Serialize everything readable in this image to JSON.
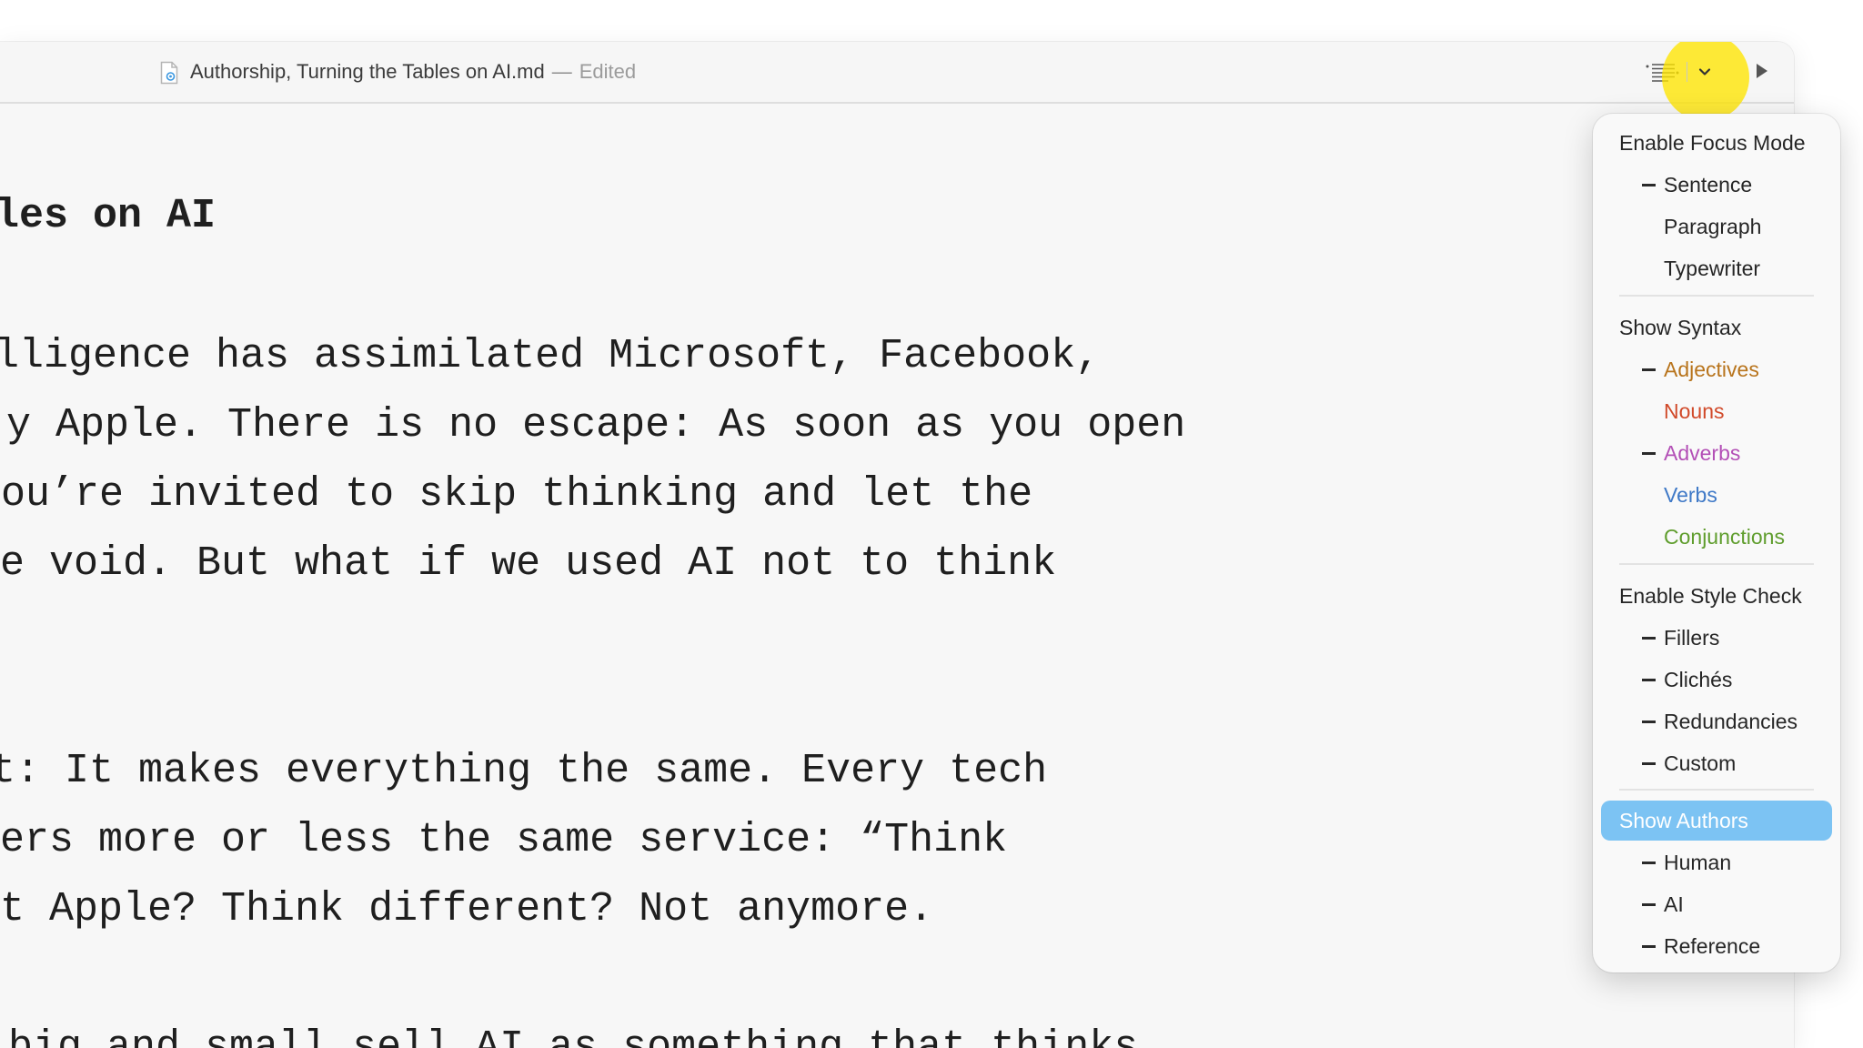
{
  "window": {
    "file_name": "Authorship, Turning the Tables on AI.md",
    "separator": "—",
    "status": "Edited"
  },
  "icons": {
    "document": "markdown-document-icon",
    "lines": "text-lines-icon",
    "chevron": "chevron-down-icon",
    "play": "play-triangle-icon"
  },
  "editor": {
    "lines": [
      "les on AI",
      "lligence has assimilated Microsoft, Facebook,",
      "y Apple. There is no escape: As soon as you open",
      "you’re invited to skip thinking and let the",
      "he void. But what if we used AI not to think",
      "t: It makes everything the same. Every tech",
      "fers more or less the same service: “Think",
      "ut Apple? Think different? Not anymore.",
      " big and small sell AI as something that thinks"
    ]
  },
  "menu": {
    "focus": {
      "header": "Enable Focus Mode",
      "items": [
        {
          "label": "Sentence",
          "checked": true
        },
        {
          "label": "Paragraph",
          "checked": false
        },
        {
          "label": "Typewriter",
          "checked": false
        }
      ]
    },
    "syntax": {
      "header": "Show Syntax",
      "items": [
        {
          "label": "Adjectives",
          "checked": true,
          "color": "#b8741c"
        },
        {
          "label": "Nouns",
          "checked": false,
          "color": "#d14a2a"
        },
        {
          "label": "Adverbs",
          "checked": true,
          "color": "#b34fb6"
        },
        {
          "label": "Verbs",
          "checked": false,
          "color": "#3f79c7"
        },
        {
          "label": "Conjunctions",
          "checked": false,
          "color": "#5f9d2d"
        }
      ]
    },
    "style_check": {
      "header": "Enable Style Check",
      "items": [
        {
          "label": "Fillers",
          "checked": true
        },
        {
          "label": "Clichés",
          "checked": true
        },
        {
          "label": "Redundancies",
          "checked": true
        },
        {
          "label": "Custom",
          "checked": true
        }
      ]
    },
    "authors": {
      "header": "Show Authors",
      "selected": true,
      "items": [
        {
          "label": "Human",
          "checked": true
        },
        {
          "label": "AI",
          "checked": true
        },
        {
          "label": "Reference",
          "checked": true
        }
      ]
    }
  },
  "colors": {
    "selection": "#7cc3f3",
    "highlight": "#ffe600"
  }
}
